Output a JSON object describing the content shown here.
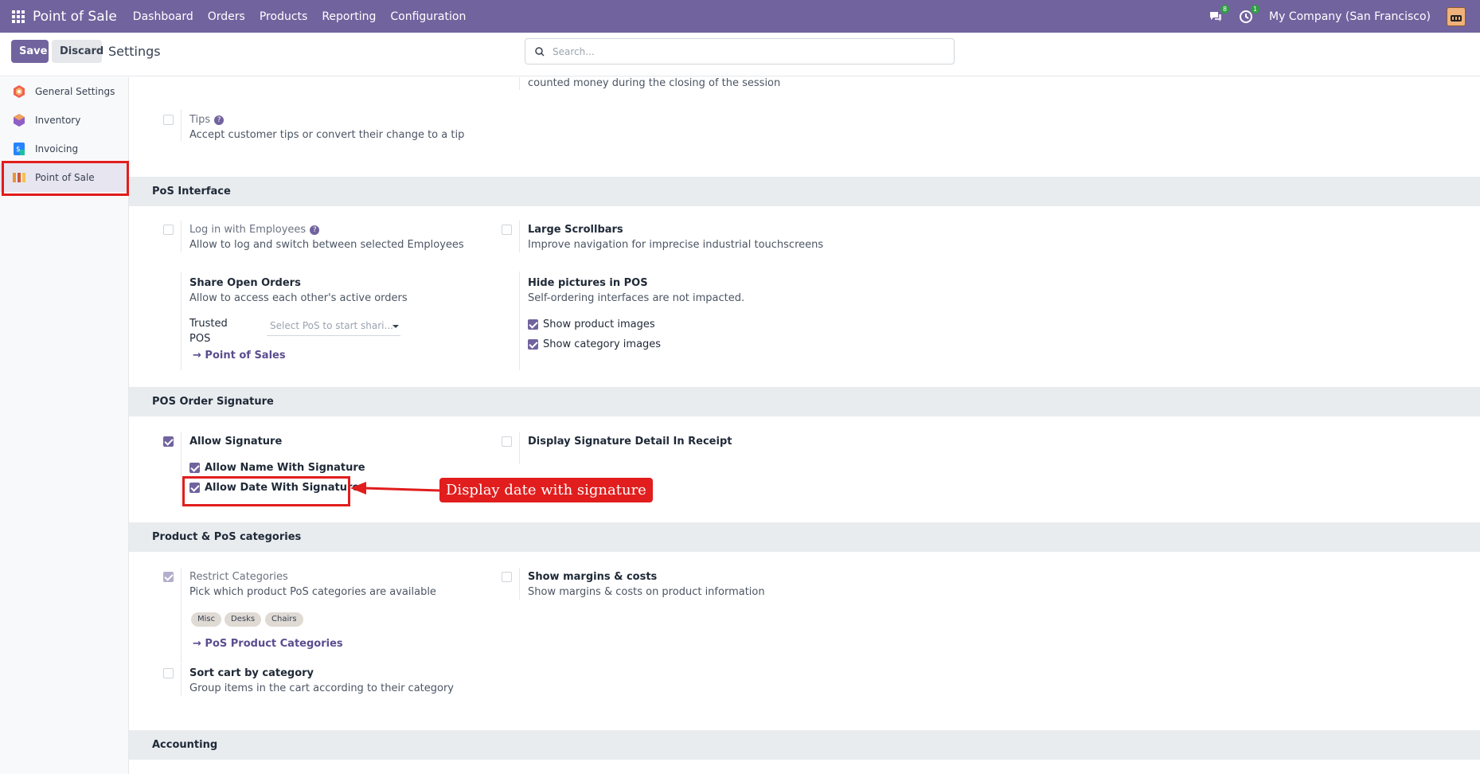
{
  "navbar": {
    "app_name": "Point of Sale",
    "menu": [
      "Dashboard",
      "Orders",
      "Products",
      "Reporting",
      "Configuration"
    ],
    "messages_badge": "8",
    "activities_badge": "1",
    "company": "My Company (San Francisco)"
  },
  "control_panel": {
    "save_label": "Save",
    "discard_label": "Discard",
    "title": "Settings",
    "search_placeholder": "Search..."
  },
  "sidebar": {
    "items": [
      {
        "label": "General Settings",
        "icon": "gear-hexagon-icon",
        "color": "#f06050"
      },
      {
        "label": "Inventory",
        "icon": "inventory-box-icon",
        "color": "#8f5fc7"
      },
      {
        "label": "Invoicing",
        "icon": "invoice-icon",
        "color": "#2684ff"
      },
      {
        "label": "Point of Sale",
        "icon": "pos-store-icon",
        "color": "#e8943a",
        "active": true
      }
    ]
  },
  "content": {
    "top_partial_desc": "counted money during the closing of the session",
    "tips": {
      "label": "Tips",
      "desc": "Accept customer tips or convert their change to a tip"
    },
    "pos_interface": {
      "title": "PoS Interface",
      "login_employees": {
        "label": "Log in with Employees",
        "desc": "Allow to log and switch between selected Employees"
      },
      "large_scrollbars": {
        "label": "Large Scrollbars",
        "desc": "Improve navigation for imprecise industrial touchscreens"
      },
      "share_orders": {
        "label": "Share Open Orders",
        "desc": "Allow to access each other's active orders",
        "trusted_label_1": "Trusted",
        "trusted_label_2": "POS",
        "trusted_placeholder": "Select PoS to start shari...",
        "link": "Point of Sales"
      },
      "hide_pictures": {
        "label": "Hide pictures in POS",
        "desc": "Self-ordering interfaces are not impacted.",
        "opt_product": "Show product images",
        "opt_category": "Show category images"
      }
    },
    "signature": {
      "title": "POS Order Signature",
      "allow_signature": "Allow Signature",
      "allow_name": "Allow Name With Signature",
      "allow_date": "Allow Date With Signature",
      "display_detail": "Display Signature Detail In Receipt"
    },
    "categories": {
      "title": "Product & PoS categories",
      "restrict": {
        "label": "Restrict Categories",
        "desc": "Pick which product PoS categories are available",
        "tags": [
          "Misc",
          "Desks",
          "Chairs"
        ],
        "link": "PoS Product Categories"
      },
      "margins": {
        "label": "Show margins & costs",
        "desc": "Show margins & costs on product information"
      },
      "sort_cart": {
        "label": "Sort cart by category",
        "desc": "Group items in the cart according to their category"
      }
    },
    "accounting": {
      "title": "Accounting"
    }
  },
  "annotation": {
    "text": "Display date with signature",
    "color": "#e11d1d"
  }
}
